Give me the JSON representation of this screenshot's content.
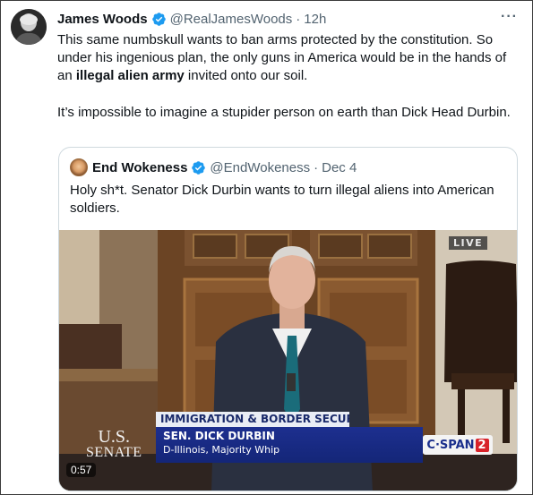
{
  "tweet": {
    "author_name": "James Woods",
    "handle": "@RealJamesWoods",
    "separator": "·",
    "time": "12h",
    "more_label": "···",
    "text_line1_a": "This same numbskull wants to ban arms protected by the constitution. So under his ingenious plan, the only guns in America would be in the hands of an ",
    "text_line1_bold": "illegal alien army",
    "text_line1_b": " invited onto our soil.",
    "text_para2": "It’s impossible to imagine a stupider person on earth than Dick Head Durbin."
  },
  "quote": {
    "author_name": "End Wokeness",
    "handle": "@EndWokeness",
    "separator": "·",
    "time": "Dec 4",
    "text": "Holy sh*t. Senator Dick Durbin wants to turn illegal aliens into American soldiers.",
    "video": {
      "live_badge": "LIVE",
      "chyron_topic": "IMMIGRATION & BORDER SECURITY",
      "chyron_name": "SEN. DICK DURBIN",
      "chyron_title": "D-Illinois, Majority Whip",
      "logo_line1": "U.S.",
      "logo_line2": "SENATE",
      "network_a": "C·SPAN",
      "network_b": "2",
      "duration": "0:57"
    }
  },
  "colors": {
    "verified_blue": "#1d9bf0",
    "secondary_text": "#536471",
    "chyron_blue": "#1d2f8f"
  },
  "icons": {
    "verified": "verified-badge-icon",
    "more": "more-options-icon"
  }
}
